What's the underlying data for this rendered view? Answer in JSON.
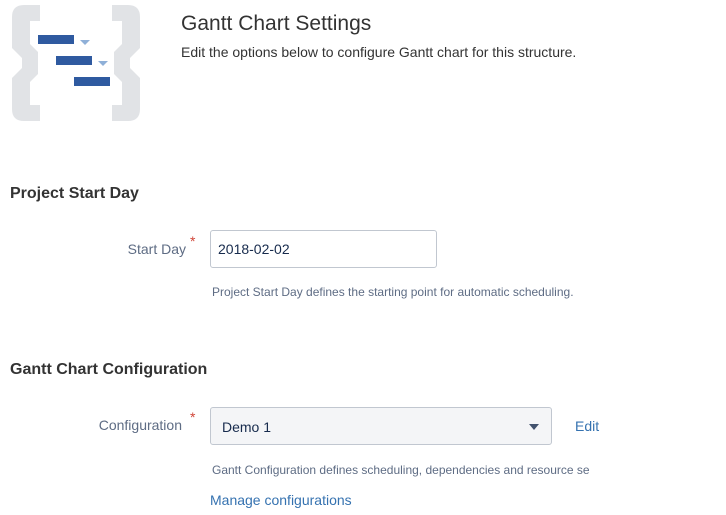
{
  "header": {
    "logo_icon": "gantt-chart-icon",
    "title": "Gantt Chart Settings",
    "description": "Edit the options below to configure Gantt chart for this structure."
  },
  "project_start": {
    "section_title": "Project Start Day",
    "field_label": "Start Day",
    "required_mark": "*",
    "value": "2018-02-02",
    "help": "Project Start Day defines the starting point for automatic scheduling."
  },
  "gantt_config": {
    "section_title": "Gantt Chart Configuration",
    "field_label": "Configuration",
    "required_mark": "*",
    "selected": "Demo 1",
    "edit_link": "Edit",
    "help": "Gantt Configuration defines scheduling, dependencies and resource se",
    "manage_link": "Manage configurations"
  },
  "colors": {
    "accent": "#3572b0",
    "required": "#d04437",
    "logo_frame": "#e1e3e6",
    "logo_bar": "#2f5aa0",
    "logo_chevron": "#8fb0d8"
  }
}
